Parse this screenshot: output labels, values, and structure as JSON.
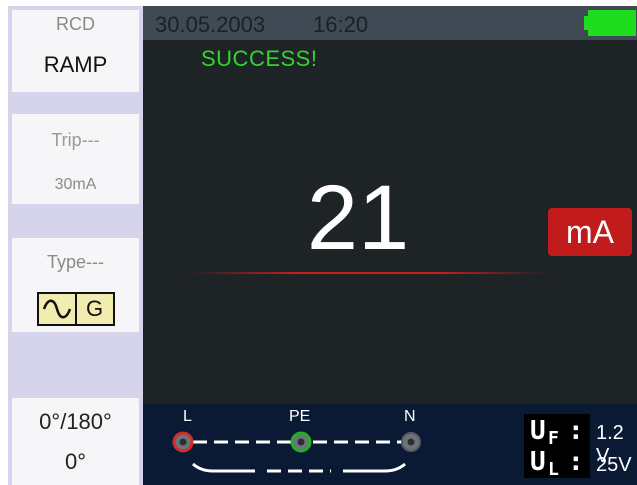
{
  "sidebar": {
    "mode_label": "RCD",
    "mode_value": "RAMP",
    "trip_label": "Trip---",
    "trip_value": "30mA",
    "type_label": "Type---",
    "type_icons": [
      "ac-sine-icon",
      "G"
    ],
    "angle_line1": "0°/180°",
    "angle_line2": "0°"
  },
  "topbar": {
    "date": "30.05.2003",
    "time": "16:20",
    "battery_color": "#1edc1e"
  },
  "main": {
    "status": "SUCCESS!",
    "reading": "21",
    "unit": "mA",
    "status_color": "#2ed62e",
    "unit_color": "#c21b1b"
  },
  "bottom": {
    "terminals": [
      "L",
      "PE",
      "N"
    ],
    "uf_symbol": "U",
    "uf_sub": "F",
    "uf_value": "1.2 V",
    "ul_symbol": "U",
    "ul_sub": "L",
    "ul_value": "25V"
  }
}
